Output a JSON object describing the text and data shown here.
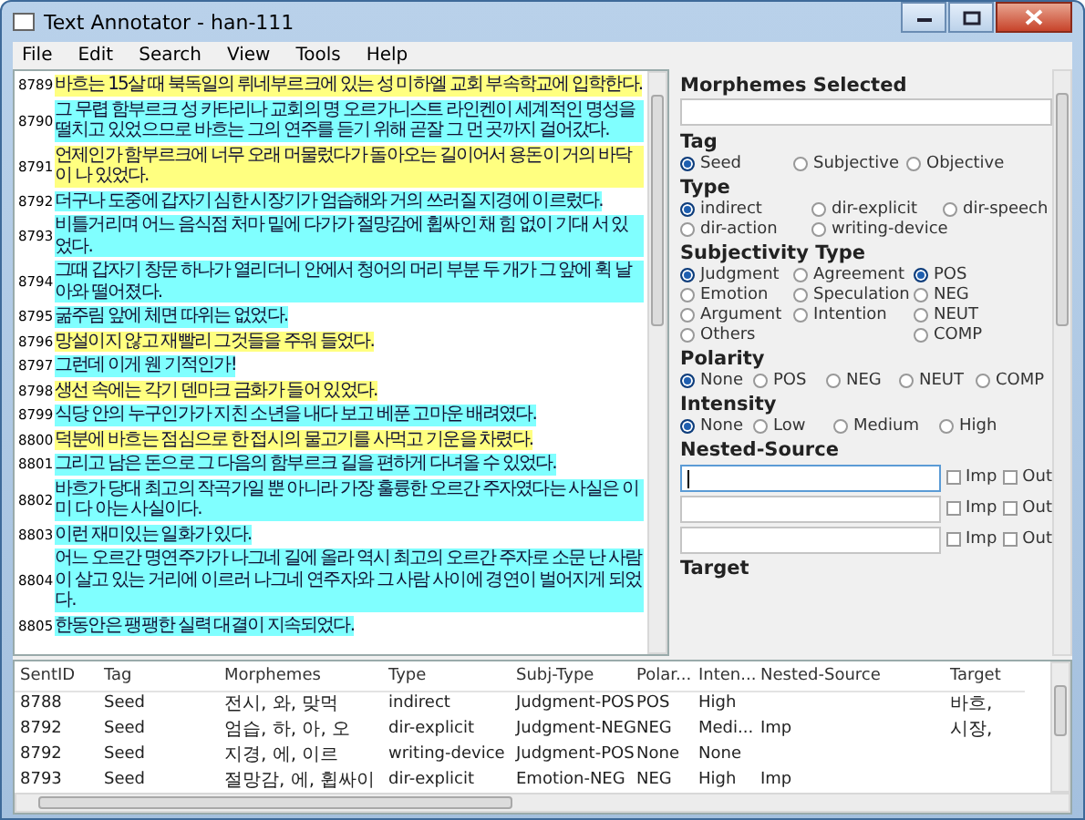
{
  "window": {
    "title": "Text Annotator - han-111"
  },
  "menu": [
    "File",
    "Edit",
    "Search",
    "View",
    "Tools",
    "Help"
  ],
  "sentences": [
    {
      "id": "8789",
      "text": "바흐는 15살 때 북독일의 뤼네부르크에 있는 성 미하엘 교회 부속학교에 입학한다.",
      "color": "#ffff80"
    },
    {
      "id": "8790",
      "text": "그 무렵 함부르크 성 카타리나 교회의 명 오르가니스트 라인켄이 세계적인 명성을 떨치고 있었으므로 바흐는 그의 연주를 듣기 위해 곧잘 그 먼 곳까지 걸어갔다.",
      "color": "#80ffff"
    },
    {
      "id": "8791",
      "text": "언제인가 함부르크에 너무 오래 머물렀다가 돌아오는 길이어서 용돈이 거의 바닥이 나 있었다.",
      "color": "#ffff80"
    },
    {
      "id": "8792",
      "text": "더구나 도중에 갑자기 심한 시장기가 엄습해와 거의 쓰러질 지경에 이르렀다.",
      "color": "#80ffff"
    },
    {
      "id": "8793",
      "text": "비틀거리며 어느 음식점 처마 밑에 다가가 절망감에 휩싸인 채 힘 없이 기대 서 있었다.",
      "color": "#80ffff"
    },
    {
      "id": "8794",
      "text": "그때 갑자기 창문 하나가 열리더니 안에서 청어의 머리 부분 두 개가 그 앞에 휙 날아와 떨어졌다.",
      "color": "#80ffff"
    },
    {
      "id": "8795",
      "text": "굶주림 앞에 체면 따위는 없었다.",
      "color": "#80ffff"
    },
    {
      "id": "8796",
      "text": "망설이지 않고 재빨리 그것들을 주워 들었다.",
      "color": "#ffff80"
    },
    {
      "id": "8797",
      "text": "그런데 이게 웬 기적인가!",
      "color": "#80ffff"
    },
    {
      "id": "8798",
      "text": "생선 속에는 각기 덴마크 금화가 들어 있었다.",
      "color": "#ffff80"
    },
    {
      "id": "8799",
      "text": "식당 안의 누구인가가 지친 소년을 내다 보고 베푼 고마운 배려였다.",
      "color": "#80ffff"
    },
    {
      "id": "8800",
      "text": "덕분에 바흐는 점심으로 한 접시의 물고기를 사먹고 기운을 차렸다.",
      "color": "#ffff80"
    },
    {
      "id": "8801",
      "text": "그리고 남은 돈으로 그 다음의 함부르크 길을 편하게 다녀올 수 있었다.",
      "color": "#80ffff"
    },
    {
      "id": "8802",
      "text": "바흐가 당대 최고의 작곡가일 뿐 아니라 가장 훌륭한 오르간 주자였다는 사실은 이미 다 아는 사실이다.",
      "color": "#80ffff"
    },
    {
      "id": "8803",
      "text": "이런 재미있는 일화가 있다.",
      "color": "#80ffff"
    },
    {
      "id": "8804",
      "text": "어느 오르간 명연주가가 나그네 길에 올라 역시 최고의 오르간 주자로 소문 난 사람이 살고 있는 거리에 이르러 나그네 연주자와 그 사람 사이에 경연이 벌어지게 되었다.",
      "color": "#80ffff"
    },
    {
      "id": "8805",
      "text": "한동안은 팽팽한 실력 대결이 지속되었다.",
      "color": "#80ffff"
    }
  ],
  "panel": {
    "morphemes_label": "Morphemes Selected",
    "tag": {
      "title": "Tag",
      "options": [
        {
          "label": "Seed",
          "selected": true
        },
        {
          "label": "Subjective",
          "selected": false
        },
        {
          "label": "Objective",
          "selected": false
        }
      ]
    },
    "type": {
      "title": "Type",
      "options": [
        {
          "label": "indirect",
          "selected": true
        },
        {
          "label": "dir-explicit",
          "selected": false
        },
        {
          "label": "dir-speech",
          "selected": false
        },
        {
          "label": "dir-action",
          "selected": false
        },
        {
          "label": "writing-device",
          "selected": false
        }
      ]
    },
    "subjectivity": {
      "title": "Subjectivity Type",
      "kinds": [
        {
          "label": "Judgment",
          "selected": true
        },
        {
          "label": "Agreement",
          "selected": false
        },
        {
          "label": "Emotion",
          "selected": false
        },
        {
          "label": "Speculation",
          "selected": false
        },
        {
          "label": "Argument",
          "selected": false
        },
        {
          "label": "Intention",
          "selected": false
        },
        {
          "label": "Others",
          "selected": false
        }
      ],
      "polarities": [
        {
          "label": "POS",
          "selected": true
        },
        {
          "label": "NEG",
          "selected": false
        },
        {
          "label": "NEUT",
          "selected": false
        },
        {
          "label": "COMP",
          "selected": false
        }
      ]
    },
    "polarity": {
      "title": "Polarity",
      "options": [
        {
          "label": "None",
          "selected": true
        },
        {
          "label": "POS",
          "selected": false
        },
        {
          "label": "NEG",
          "selected": false
        },
        {
          "label": "NEUT",
          "selected": false
        },
        {
          "label": "COMP",
          "selected": false
        }
      ]
    },
    "intensity": {
      "title": "Intensity",
      "options": [
        {
          "label": "None",
          "selected": true
        },
        {
          "label": "Low",
          "selected": false
        },
        {
          "label": "Medium",
          "selected": false
        },
        {
          "label": "High",
          "selected": false
        }
      ]
    },
    "nested": {
      "title": "Nested-Source",
      "rows": [
        {
          "focused": true,
          "imp": {
            "label": "Imp",
            "checked": false
          },
          "out": {
            "label": "Out",
            "checked": false
          }
        },
        {
          "focused": false,
          "imp": {
            "label": "Imp",
            "checked": false
          },
          "out": {
            "label": "Out",
            "checked": false
          }
        },
        {
          "focused": false,
          "imp": {
            "label": "Imp",
            "checked": false
          },
          "out": {
            "label": "Out",
            "checked": false
          }
        }
      ]
    },
    "target_label": "Target"
  },
  "table": {
    "columns": [
      "SentID",
      "Tag",
      "Morphemes",
      "Type",
      "Subj-Type",
      "Polar...",
      "Inten...",
      "Nested-Source",
      "Target"
    ],
    "rows": [
      [
        "8788",
        "Seed",
        "전시, 와, 맞먹",
        "indirect",
        "Judgment-POS",
        "POS",
        "High",
        "",
        "바흐,"
      ],
      [
        "8792",
        "Seed",
        "엄습, 하, 아, 오",
        "dir-explicit",
        "Judgment-NEG",
        "NEG",
        "Medi...",
        "Imp",
        "시장,"
      ],
      [
        "8792",
        "Seed",
        "지경, 에, 이르",
        "writing-device",
        "Judgment-POS",
        "None",
        "None",
        "",
        ""
      ],
      [
        "8793",
        "Seed",
        "절망감, 에, 휩싸이",
        "dir-explicit",
        "Emotion-NEG",
        "NEG",
        "High",
        "Imp",
        ""
      ]
    ]
  }
}
